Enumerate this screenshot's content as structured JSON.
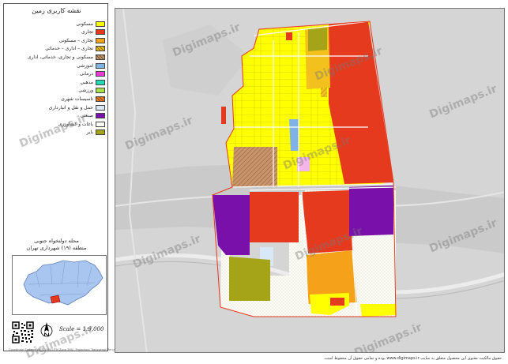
{
  "legend": {
    "title": "نقشه کاربری زمین",
    "items": [
      {
        "label": "مسکونی",
        "color": "#ffff00",
        "hatched": false
      },
      {
        "label": "تجاری",
        "color": "#e63a1f",
        "hatched": false
      },
      {
        "label": "تجاری – مسکونی",
        "color": "#f5a21a",
        "hatched": false
      },
      {
        "label": "تجاری – اداری – خدماتی",
        "color": "#f2c11d",
        "hatched": true
      },
      {
        "label": "مسکونی و تجاری، خدماتی، اداری",
        "color": "#c8956b",
        "hatched": true
      },
      {
        "label": "آموزشی",
        "color": "#7fb2e5",
        "hatched": false
      },
      {
        "label": "درمانی",
        "color": "#ec3cd7",
        "hatched": false
      },
      {
        "label": "مذهبی",
        "color": "#23d9b5",
        "hatched": false
      },
      {
        "label": "ورزشی",
        "color": "#a6e14b",
        "hatched": false
      },
      {
        "label": "تاسیسات شهری",
        "color": "#f17f1f",
        "hatched": true
      },
      {
        "label": "حمل و نقل و انبارداری",
        "color": "#d9e8f7",
        "hatched": false
      },
      {
        "label": "صنعتی",
        "color": "#7a10aa",
        "hatched": false
      },
      {
        "label": "باغات و کشاورزی",
        "color": "#fdfdf5",
        "hatched": false
      },
      {
        "label": "بایر",
        "color": "#a5a318",
        "hatched": false
      }
    ]
  },
  "locator": {
    "title_line1": "محله دولتخواه جنوبی",
    "title_line2": "منطقه (۱۹) شهرداری تهران"
  },
  "scale": "Scale = 1:9,000",
  "coord_note": "Coordinate System: WGS 1984 UTM Zone 39N | Projection: Transverse Mercator",
  "copyright": "حقوق مالکیت معنوی این محصول متعلق به سایت www.digimaps.ir بوده و تمامی حقوق آن محفوظ است.",
  "watermark": "Digimaps.ir",
  "icons": {
    "north": "north-arrow-icon",
    "qr": "qr-code-icon"
  }
}
